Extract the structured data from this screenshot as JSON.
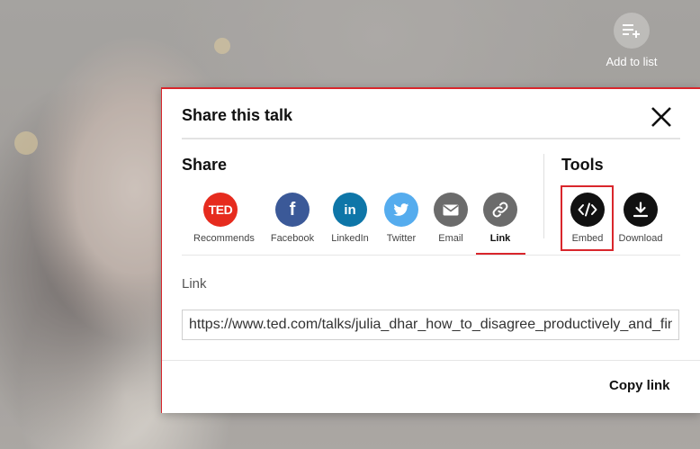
{
  "video": {
    "add_to_list_label": "Add to list",
    "add_to_list_icon": "playlist-add-icon"
  },
  "modal": {
    "title": "Share this talk",
    "close_icon": "close-icon",
    "share_heading": "Share",
    "tools_heading": "Tools",
    "share_options": [
      {
        "label": "Recommends",
        "icon": "ted-logo-icon",
        "color": "#e62b1e"
      },
      {
        "label": "Facebook",
        "icon": "facebook-icon",
        "color": "#3b5998"
      },
      {
        "label": "LinkedIn",
        "icon": "linkedin-icon",
        "color": "#0e76a8"
      },
      {
        "label": "Twitter",
        "icon": "twitter-icon",
        "color": "#55acee"
      },
      {
        "label": "Email",
        "icon": "email-icon",
        "color": "#6b6b6b"
      },
      {
        "label": "Link",
        "icon": "link-icon",
        "color": "#6b6b6b",
        "selected": true
      }
    ],
    "tools": [
      {
        "label": "Embed",
        "icon": "embed-code-icon",
        "color": "#111111"
      },
      {
        "label": "Download",
        "icon": "download-icon",
        "color": "#111111"
      }
    ],
    "link_label": "Link",
    "link_value": "https://www.ted.com/talks/julia_dhar_how_to_disagree_productively_and_find_common_ground",
    "copy_link_label": "Copy link",
    "accent_color": "#d9262c"
  }
}
